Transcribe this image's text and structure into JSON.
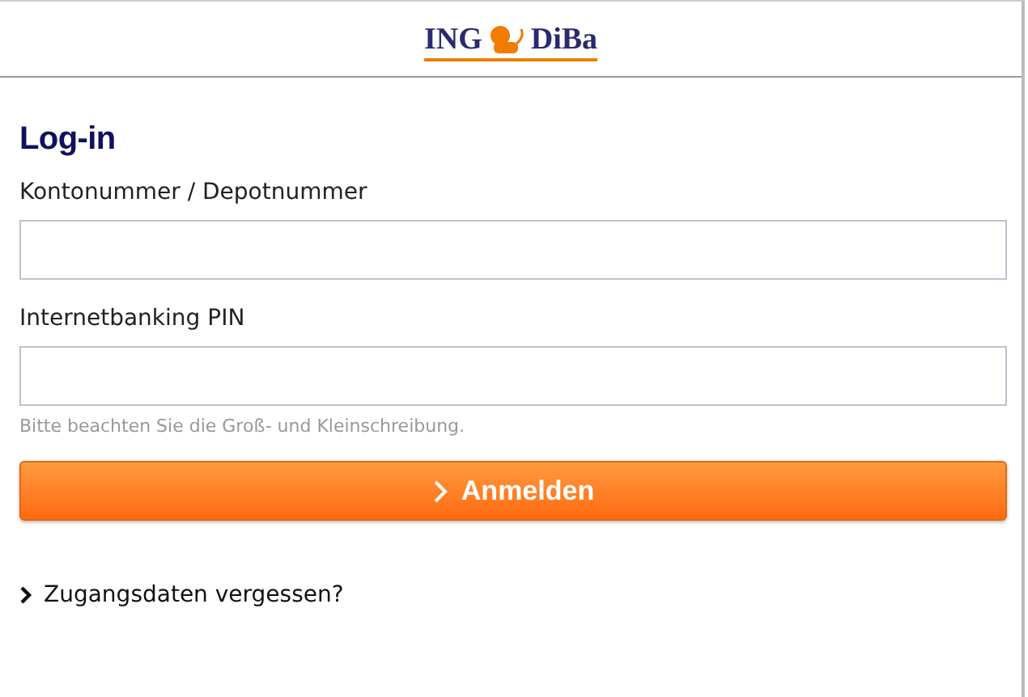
{
  "logo": {
    "left": "ING",
    "right": "DiBa"
  },
  "title": "Log-in",
  "fields": [
    {
      "label": "Kontonummer / Depotnummer"
    },
    {
      "label": "Internetbanking PIN"
    }
  ],
  "hint": "Bitte beachten Sie die Groß- und Kleinschreibung.",
  "submit": "Anmelden",
  "link": "Zugangsdaten vergessen?"
}
